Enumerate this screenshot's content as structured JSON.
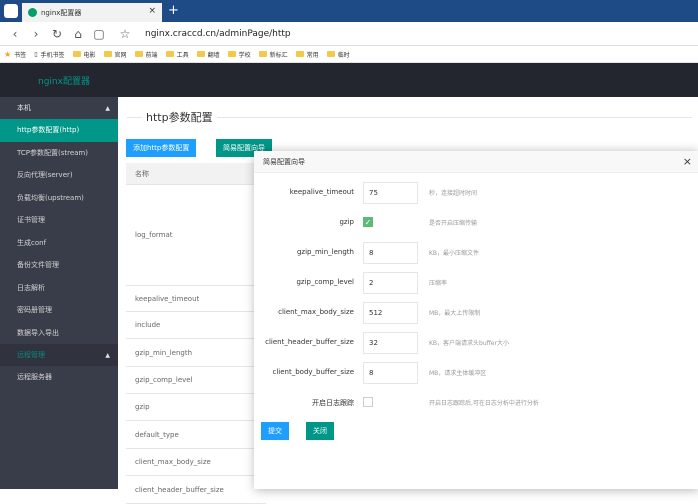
{
  "browser": {
    "tab_title": "nginx配置器",
    "tab_close": "×",
    "new_tab": "+",
    "address": "nginx.craccd.cn/adminPage/http",
    "bookmarks": [
      "书签",
      "手机书签",
      "电影",
      "官网",
      "前端",
      "工具",
      "翻墙",
      "学校",
      "新标汇",
      "常用",
      "临时"
    ]
  },
  "app": {
    "brand": "nginx配置器"
  },
  "sidebar": {
    "group1": "本机",
    "items": [
      "http参数配置(http)",
      "TCP参数配置(stream)",
      "反向代理(server)",
      "负载均衡(upstream)",
      "证书管理",
      "生成conf",
      "备份文件管理",
      "日志解析",
      "密码册管理",
      "数据导入导出"
    ],
    "group2": "远程管理",
    "items2": [
      "远程服务器"
    ]
  },
  "main": {
    "title": "http参数配置",
    "add_button": "添加http参数配置",
    "wizard_button": "简易配置向导",
    "table_header": "名称",
    "rows": [
      "log_format",
      "keepalive_timeout",
      "include",
      "gzip_min_length",
      "gzip_comp_level",
      "gzip",
      "default_type",
      "client_max_body_size",
      "client_header_buffer_size"
    ]
  },
  "modal": {
    "title": "简易配置向导",
    "close": "×",
    "fields": [
      {
        "label": "keepalive_timeout",
        "value": "75",
        "hint": "秒，连接超时时间"
      },
      {
        "label": "gzip",
        "checked": true,
        "hint": "是否开启压缩传输"
      },
      {
        "label": "gzip_min_length",
        "value": "8",
        "hint": "KB，最小压缩文件"
      },
      {
        "label": "gzip_comp_level",
        "value": "2",
        "hint": "压缩率"
      },
      {
        "label": "client_max_body_size",
        "value": "512",
        "hint": "MB，最大上传限制"
      },
      {
        "label": "client_header_buffer_size",
        "value": "32",
        "hint": "KB，客户端请求头buffer大小"
      },
      {
        "label": "client_body_buffer_size",
        "value": "8",
        "hint": "MB，请求主体缓冲区"
      },
      {
        "label": "开启日志跟踪",
        "checked": false,
        "hint": "开启日志跟踪后,可在日志分析中进行分析"
      }
    ],
    "submit": "提交",
    "close_button": "关闭"
  },
  "colors": {
    "accent": "#009688",
    "blue": "#1e9fff",
    "sidebar": "#393d49",
    "topbar": "#23262e"
  }
}
